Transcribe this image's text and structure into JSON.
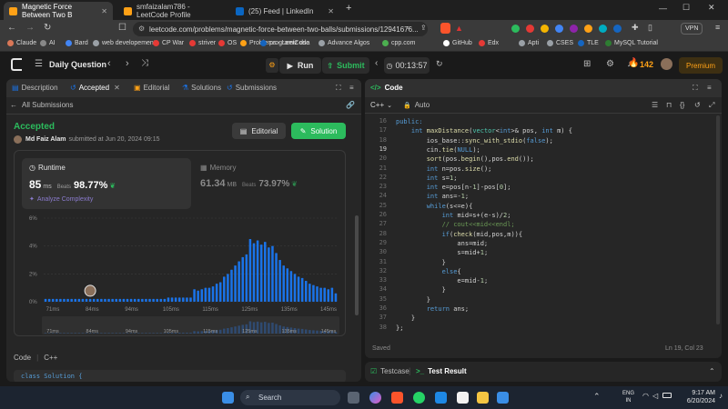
{
  "browser": {
    "tabs": [
      {
        "title": "Magnetic Force Between Two B",
        "active": true,
        "color": "#ffa116"
      },
      {
        "title": "smfaizalam786 - LeetCode Profile",
        "active": false,
        "color": "#ffa116"
      },
      {
        "title": "(25) Feed | LinkedIn",
        "active": false,
        "color": "#0a66c2"
      }
    ],
    "new_tab": "+",
    "url": "leetcode.com/problems/magnetic-force-between-two-balls/submissions/12941676...",
    "vpn_label": "VPN",
    "bookmarks": [
      {
        "label": "Claude",
        "color": "#d97757"
      },
      {
        "label": "AI",
        "color": "#888888"
      },
      {
        "label": "Bard",
        "color": "#4285f4"
      },
      {
        "label": "web developement",
        "color": "#9aa0a6"
      },
      {
        "label": "CP War",
        "color": "#e53935"
      },
      {
        "label": "striver",
        "color": "#e53935"
      },
      {
        "label": "OS",
        "color": "#e53935"
      },
      {
        "label": "Problems - LeetCode",
        "color": "#ffa116"
      },
      {
        "label": "programiz dsa",
        "color": "#1565c0"
      },
      {
        "label": "Advance Algos",
        "color": "#9aa0a6"
      },
      {
        "label": "cpp.com",
        "color": "#4caf50"
      },
      {
        "label": "GitHub",
        "color": "#ffffff"
      },
      {
        "label": "Edx",
        "color": "#e53935"
      },
      {
        "label": "Apti",
        "color": "#9aa0a6"
      },
      {
        "label": "CSES",
        "color": "#9aa0a6"
      },
      {
        "label": "TLE",
        "color": "#1565c0"
      },
      {
        "label": "MySQL Tutorial",
        "color": "#2e7d32"
      }
    ]
  },
  "lc_nav": {
    "problem_list": "Daily Question",
    "run": "Run",
    "submit": "Submit",
    "timer": "00:13:57",
    "streak": "142",
    "premium": "Premium"
  },
  "left_panel": {
    "tabs": [
      "Description",
      "Accepted",
      "Editorial",
      "Solutions",
      "Submissions"
    ],
    "all_submissions": "All Submissions",
    "status": "Accepted",
    "user": "Md Faiz Alam",
    "submitted_text": "submitted at Jun 20, 2024 09:15",
    "editorial_btn": "Editorial",
    "solution_btn": "Solution",
    "runtime": {
      "label": "Runtime",
      "value": "85",
      "unit": "ms",
      "beats_label": "Beats",
      "beats": "98.77%",
      "analyze": "Analyze Complexity"
    },
    "memory": {
      "label": "Memory",
      "value": "61.34",
      "unit": "MB",
      "beats_label": "Beats",
      "beats": "73.97%"
    },
    "code_lang_label": "Code",
    "code_lang": "C++",
    "code_peek": "class Solution {"
  },
  "chart_data": {
    "type": "bar",
    "ylim": [
      0,
      6
    ],
    "yticks": [
      "0%",
      "2%",
      "4%",
      "6%"
    ],
    "xticks": [
      "71ms",
      "84ms",
      "94ms",
      "105ms",
      "115ms",
      "125ms",
      "135ms",
      "145ms"
    ],
    "values": [
      0.2,
      0.2,
      0.2,
      0.2,
      0.2,
      0.2,
      0.2,
      0.2,
      0.2,
      0.2,
      0.2,
      0.2,
      0.2,
      0.2,
      0.2,
      0.2,
      0.2,
      0.2,
      0.2,
      0.2,
      0.2,
      0.2,
      0.2,
      0.2,
      0.2,
      0.2,
      0.2,
      0.2,
      0.2,
      0.2,
      0.2,
      0.2,
      0.2,
      0.3,
      0.3,
      0.3,
      0.3,
      0.3,
      0.3,
      0.3,
      0.9,
      0.8,
      0.9,
      1.0,
      1.0,
      1.1,
      1.3,
      1.4,
      1.8,
      2.0,
      2.3,
      2.6,
      2.9,
      3.2,
      3.4,
      4.5,
      4.2,
      4.4,
      4.1,
      4.3,
      3.9,
      4.0,
      3.5,
      3.0,
      2.6,
      2.4,
      2.2,
      2.0,
      1.8,
      1.7,
      1.5,
      1.3,
      1.2,
      1.1,
      1.0,
      1.0,
      0.9,
      1.0,
      0.6
    ],
    "user_bar_index": 12,
    "bar_color": "#1a73e8",
    "faded_color": "#2f4a70"
  },
  "editor": {
    "tab": "Code",
    "lang": "C++",
    "auto": "Auto",
    "status_saved": "Saved",
    "cursor": "Ln 19, Col 23",
    "start_line": 16,
    "lines": [
      [
        [
          "public:",
          "kw"
        ]
      ],
      [
        [
          "    ",
          "pl"
        ],
        [
          "int",
          "kw"
        ],
        [
          " ",
          "pl"
        ],
        [
          "maxDistance",
          "fn"
        ],
        [
          "(",
          "pl"
        ],
        [
          "vector",
          "ty"
        ],
        [
          "<",
          "pl"
        ],
        [
          "int",
          "kw"
        ],
        [
          ">& pos, ",
          "pl"
        ],
        [
          "int",
          "kw"
        ],
        [
          " m) {",
          "pl"
        ]
      ],
      [
        [
          "        ios_base::",
          "pl"
        ],
        [
          "sync_with_stdio",
          "fn"
        ],
        [
          "(",
          "pl"
        ],
        [
          "false",
          "kw"
        ],
        [
          ");",
          "pl"
        ]
      ],
      [
        [
          "        cin.",
          "pl"
        ],
        [
          "tie",
          "fn"
        ],
        [
          "(",
          "pl"
        ],
        [
          "NULL",
          "kw"
        ],
        [
          ");",
          "pl"
        ]
      ],
      [
        [
          "        ",
          "pl"
        ],
        [
          "sort",
          "fn"
        ],
        [
          "(pos.",
          "pl"
        ],
        [
          "begin",
          "fn"
        ],
        [
          "(),pos.",
          "pl"
        ],
        [
          "end",
          "fn"
        ],
        [
          "());",
          "pl"
        ]
      ],
      [
        [
          "        ",
          "pl"
        ],
        [
          "int",
          "kw"
        ],
        [
          " n=pos.",
          "pl"
        ],
        [
          "size",
          "fn"
        ],
        [
          "();",
          "pl"
        ]
      ],
      [
        [
          "        ",
          "pl"
        ],
        [
          "int",
          "kw"
        ],
        [
          " s=",
          "pl"
        ],
        [
          "1",
          "num"
        ],
        [
          ";",
          "pl"
        ]
      ],
      [
        [
          "        ",
          "pl"
        ],
        [
          "int",
          "kw"
        ],
        [
          " e=pos[n-",
          "pl"
        ],
        [
          "1",
          "num"
        ],
        [
          "]-pos[",
          "pl"
        ],
        [
          "0",
          "num"
        ],
        [
          "];",
          "pl"
        ]
      ],
      [
        [
          "        ",
          "pl"
        ],
        [
          "int",
          "kw"
        ],
        [
          " ans=-",
          "pl"
        ],
        [
          "1",
          "num"
        ],
        [
          ";",
          "pl"
        ]
      ],
      [
        [
          "        ",
          "pl"
        ],
        [
          "while",
          "kw"
        ],
        [
          "(s<=e){",
          "pl"
        ]
      ],
      [
        [
          "            ",
          "pl"
        ],
        [
          "int",
          "kw"
        ],
        [
          " mid=s+(e-s)/",
          "pl"
        ],
        [
          "2",
          "num"
        ],
        [
          ";",
          "pl"
        ]
      ],
      [
        [
          "            ",
          "pl"
        ],
        [
          "// cout<<mid<<endl;",
          "cm"
        ]
      ],
      [
        [
          "            ",
          "pl"
        ],
        [
          "if",
          "kw"
        ],
        [
          "(",
          "pl"
        ],
        [
          "check",
          "fn"
        ],
        [
          "(mid,pos,m)){",
          "pl"
        ]
      ],
      [
        [
          "                ans=mid;",
          "pl"
        ]
      ],
      [
        [
          "                s=mid+",
          "pl"
        ],
        [
          "1",
          "num"
        ],
        [
          ";",
          "pl"
        ]
      ],
      [
        [
          "            }",
          "pl"
        ]
      ],
      [
        [
          "            ",
          "pl"
        ],
        [
          "else",
          "kw"
        ],
        [
          "{",
          "pl"
        ]
      ],
      [
        [
          "                e=mid-",
          "pl"
        ],
        [
          "1",
          "num"
        ],
        [
          ";",
          "pl"
        ]
      ],
      [
        [
          "            }",
          "pl"
        ]
      ],
      [
        [
          "        }",
          "pl"
        ]
      ],
      [
        [
          "        ",
          "pl"
        ],
        [
          "return",
          "kw"
        ],
        [
          " ans;",
          "pl"
        ]
      ],
      [
        [
          "    }",
          "pl"
        ]
      ],
      [
        [
          "};",
          "pl"
        ]
      ]
    ]
  },
  "testpanel": {
    "testcase": "Testcase",
    "result": "Test Result"
  },
  "taskbar": {
    "search": "Search",
    "lang_top": "ENG",
    "lang_bottom": "IN",
    "time": "9:17 AM",
    "date": "6/20/2024"
  }
}
